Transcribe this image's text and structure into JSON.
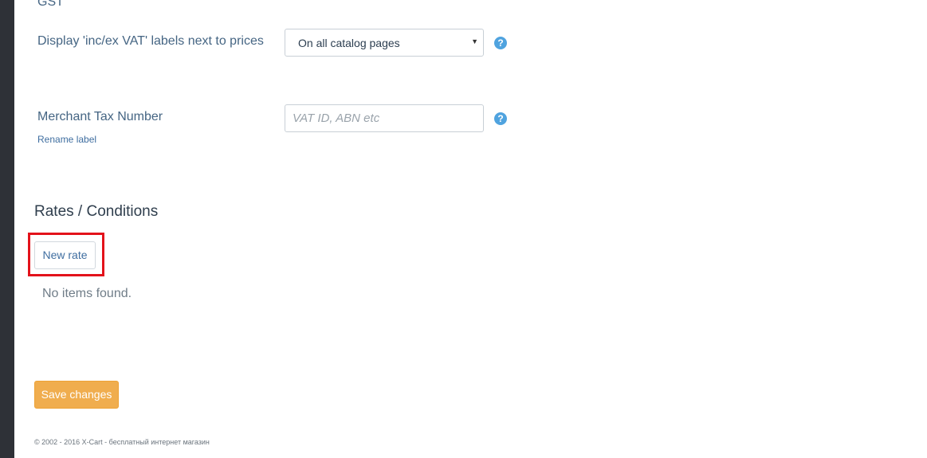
{
  "settings": {
    "section_label": "GST",
    "vat_labels": {
      "label": "Display 'inc/ex VAT' labels next to prices",
      "selected_value": "On all catalog pages",
      "help_icon": "question-circle-icon"
    },
    "merchant_tax": {
      "label": "Merchant Tax Number",
      "placeholder": "VAT ID, ABN etc",
      "value": "",
      "rename_link": "Rename label",
      "help_icon": "question-circle-icon"
    }
  },
  "rates": {
    "title": "Rates / Conditions",
    "new_rate_button": "New rate",
    "empty_message": "No items found."
  },
  "actions": {
    "save_button": "Save changes"
  },
  "footer": {
    "text": "© 2002 - 2016 X-Cart - бесплатный интернет магазин"
  },
  "colors": {
    "accent_button": "#f0ad4e",
    "help_icon": "#4fa3df",
    "highlight_border": "#e3121b",
    "sidebar": "#2e3137"
  }
}
